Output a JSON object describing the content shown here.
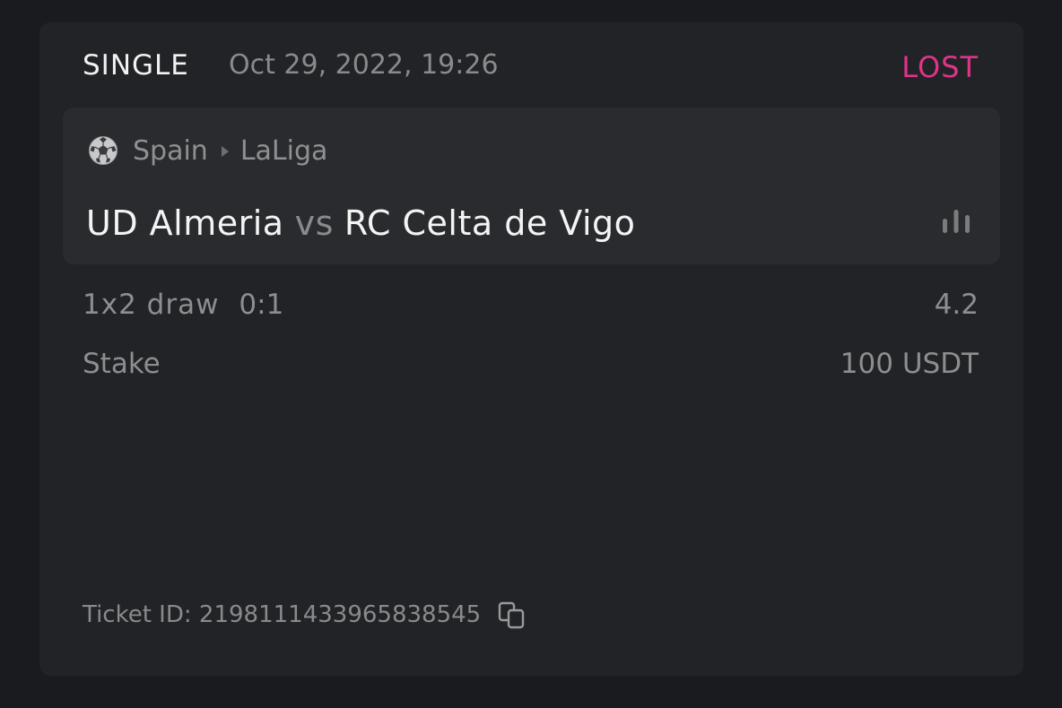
{
  "bet": {
    "type": "SINGLE",
    "date": "Oct 29, 2022, 19:26",
    "status": "LOST",
    "status_color": "#e0338a"
  },
  "event": {
    "sport_icon": "soccer-ball-icon",
    "country": "Spain",
    "separator_icon": "caret-right-icon",
    "league": "LaLiga",
    "home_team": "UD Almeria",
    "vs": "vs",
    "away_team": "RC Celta de Vigo",
    "stats_icon": "bar-chart-icon"
  },
  "selection": {
    "market": "1x2 draw",
    "score": "0:1",
    "odds": "4.2"
  },
  "stake": {
    "label": "Stake",
    "value": "100 USDT"
  },
  "ticket": {
    "label": "Ticket ID: 2198111433965838545",
    "copy_icon": "copy-icon"
  }
}
